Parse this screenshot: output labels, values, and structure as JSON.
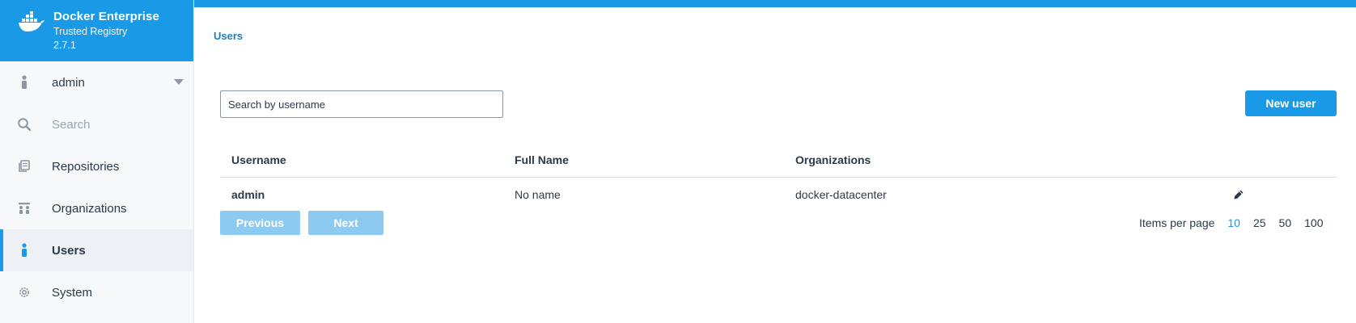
{
  "brand": {
    "name": "Docker Enterprise",
    "product": "Trusted Registry",
    "version": "2.7.1",
    "color": "#1a9ae6"
  },
  "sidebar": {
    "items": [
      {
        "label": "admin",
        "icon": "user-icon"
      },
      {
        "label": "Search",
        "icon": "search-icon"
      },
      {
        "label": "Repositories",
        "icon": "repositories-icon"
      },
      {
        "label": "Organizations",
        "icon": "organizations-icon"
      },
      {
        "label": "Users",
        "icon": "user-icon",
        "active": true
      },
      {
        "label": "System",
        "icon": "gear-icon"
      }
    ]
  },
  "breadcrumb": "Users",
  "search": {
    "placeholder": "Search by username"
  },
  "toolbar": {
    "new_user_label": "New user"
  },
  "table": {
    "columns": [
      "Username",
      "Full Name",
      "Organizations"
    ],
    "rows": [
      {
        "username": "admin",
        "full_name": "No name",
        "organizations": "docker-datacenter"
      }
    ]
  },
  "pagination": {
    "previous_label": "Previous",
    "next_label": "Next",
    "items_per_page_label": "Items per page",
    "options": [
      "10",
      "25",
      "50",
      "100"
    ],
    "selected": "10"
  }
}
